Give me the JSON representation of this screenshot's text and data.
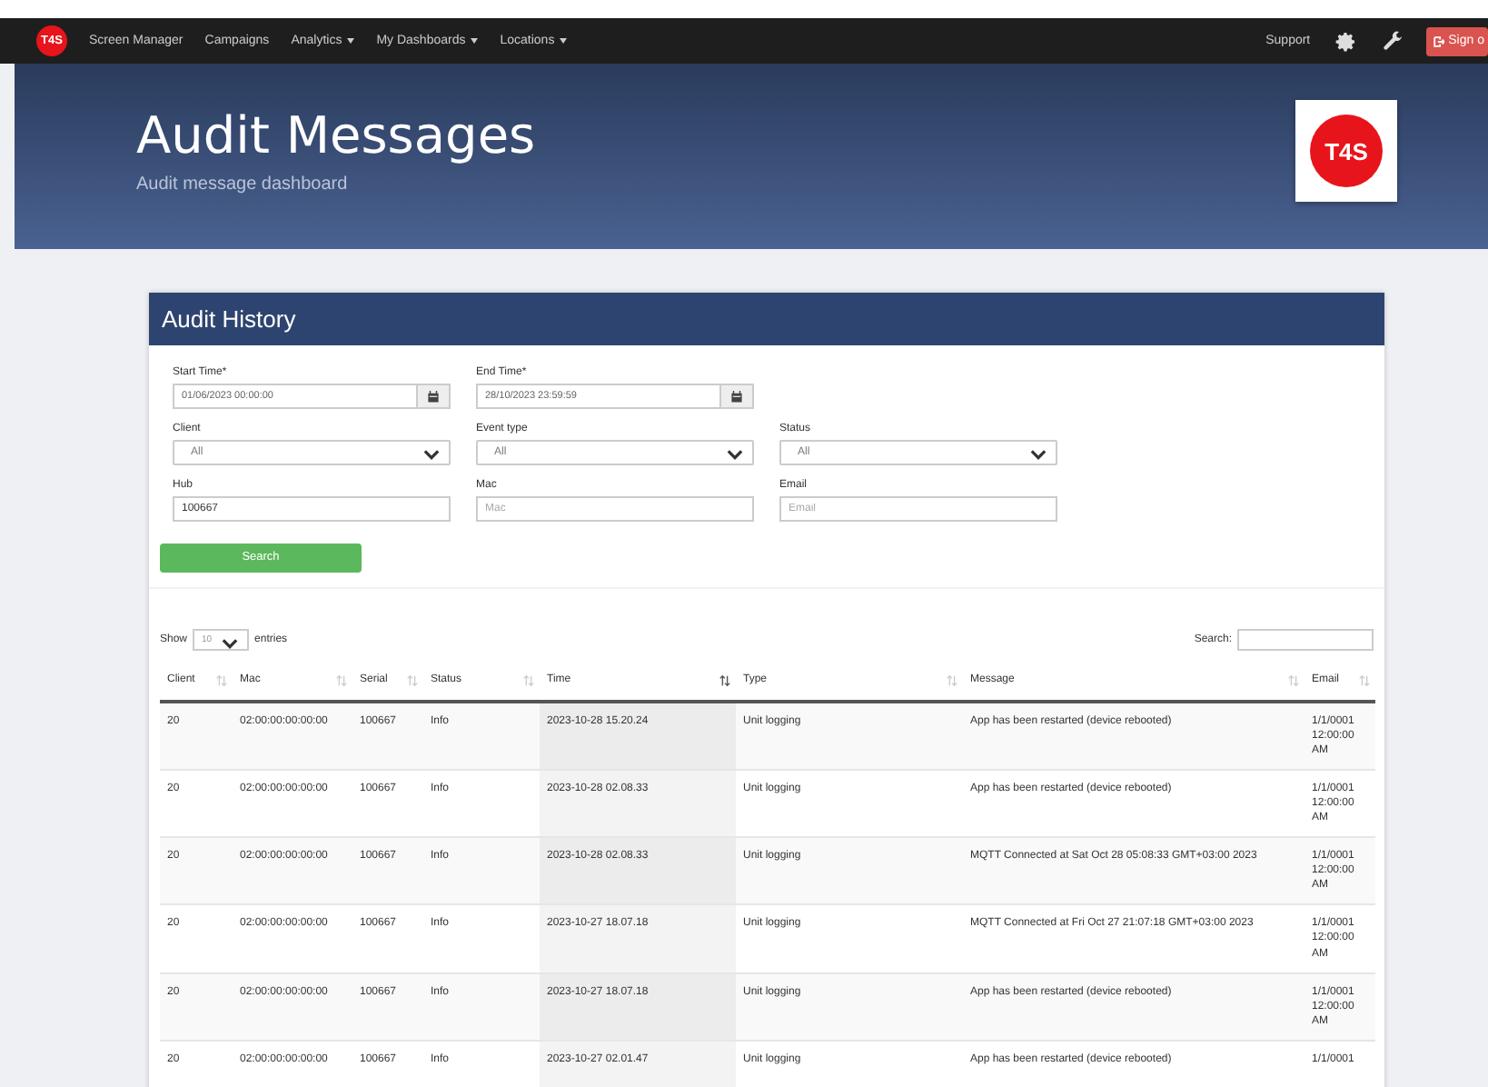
{
  "nav": {
    "logo": "T4S",
    "items": [
      {
        "label": "Screen Manager",
        "dropdown": false
      },
      {
        "label": "Campaigns",
        "dropdown": false
      },
      {
        "label": "Analytics",
        "dropdown": true
      },
      {
        "label": "My Dashboards",
        "dropdown": true
      },
      {
        "label": "Locations",
        "dropdown": true
      }
    ],
    "support": "Support",
    "sign_out": "Sign o"
  },
  "header": {
    "title": "Audit Messages",
    "subtitle": "Audit message dashboard",
    "logo": "T4S"
  },
  "panel": {
    "title": "Audit History",
    "filters": [
      [
        {
          "kind": "date",
          "label": "Start Time*",
          "value": "01/06/2023 00:00:00"
        },
        {
          "kind": "date",
          "label": "End Time*",
          "value": "28/10/2023 23:59:59"
        }
      ],
      [
        {
          "kind": "select",
          "label": "Client",
          "value": "All"
        },
        {
          "kind": "select",
          "label": "Event type",
          "value": "All"
        },
        {
          "kind": "select",
          "label": "Status",
          "value": "All"
        }
      ],
      [
        {
          "kind": "text",
          "label": "Hub",
          "value": "100667"
        },
        {
          "kind": "text",
          "label": "Mac",
          "placeholder": "Mac"
        },
        {
          "kind": "text",
          "label": "Email",
          "placeholder": "Email"
        }
      ]
    ],
    "search_button": "Search",
    "show_label": "Show",
    "page_size": "10",
    "entries_label": "entries",
    "search_label": "Search:",
    "columns": [
      {
        "label": "Client",
        "sorted": false
      },
      {
        "label": "Mac",
        "sorted": false
      },
      {
        "label": "Serial",
        "sorted": false
      },
      {
        "label": "Status",
        "sorted": false
      },
      {
        "label": "Time",
        "sorted": true
      },
      {
        "label": "Type",
        "sorted": false
      },
      {
        "label": "Message",
        "sorted": false
      },
      {
        "label": "Email",
        "sorted": false
      }
    ],
    "rows": [
      [
        "20",
        "02:00:00:00:00:00",
        "100667",
        "Info",
        "2023-10-28 15.20.24",
        "Unit logging",
        "App has been restarted (device rebooted)",
        "1/1/0001 12:00:00 AM"
      ],
      [
        "20",
        "02:00:00:00:00:00",
        "100667",
        "Info",
        "2023-10-28 02.08.33",
        "Unit logging",
        "App has been restarted (device rebooted)",
        "1/1/0001 12:00:00 AM"
      ],
      [
        "20",
        "02:00:00:00:00:00",
        "100667",
        "Info",
        "2023-10-28 02.08.33",
        "Unit logging",
        "MQTT Connected at Sat Oct 28 05:08:33 GMT+03:00 2023",
        "1/1/0001 12:00:00 AM"
      ],
      [
        "20",
        "02:00:00:00:00:00",
        "100667",
        "Info",
        "2023-10-27 18.07.18",
        "Unit logging",
        "MQTT Connected at Fri Oct 27 21:07:18 GMT+03:00 2023",
        "1/1/0001 12:00:00 AM"
      ],
      [
        "20",
        "02:00:00:00:00:00",
        "100667",
        "Info",
        "2023-10-27 18.07.18",
        "Unit logging",
        "App has been restarted (device rebooted)",
        "1/1/0001 12:00:00 AM"
      ],
      [
        "20",
        "02:00:00:00:00:00",
        "100667",
        "Info",
        "2023-10-27 02.01.47",
        "Unit logging",
        "App has been restarted (device rebooted)",
        "1/1/0001"
      ]
    ]
  }
}
